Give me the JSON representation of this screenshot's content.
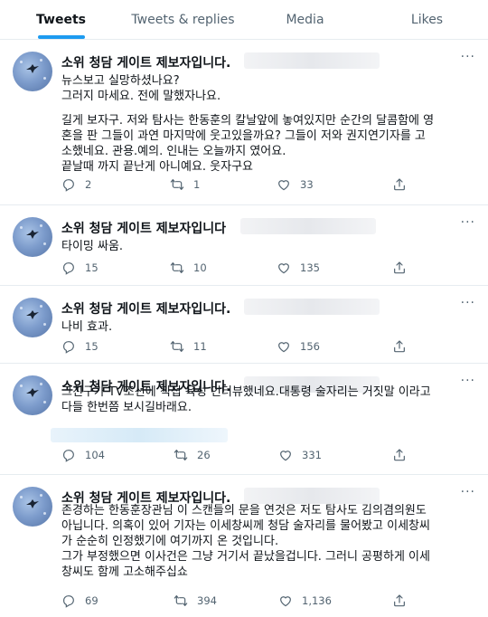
{
  "tabs": [
    {
      "label": "Tweets"
    },
    {
      "label": "Tweets & replies"
    },
    {
      "label": "Media"
    },
    {
      "label": "Likes"
    }
  ],
  "icons": {
    "more": "more-icon",
    "reply": "reply-icon",
    "retweet": "retweet-icon",
    "like": "like-icon",
    "share": "share-icon"
  },
  "colors": {
    "accent": "#1d9bf0",
    "text": "#0f1419",
    "muted": "#536471"
  },
  "tweets": [
    {
      "author": "소위 청담 게이트 제보자입니다.",
      "more": "···",
      "lines": [
        "뉴스보고 실망하셨나요?",
        "그러지 마세요. 전에 말했자나요.",
        "",
        "길게 보자구. 저와 탐사는 한동훈의 칼날앞에 놓여있지만 순간의 달콤함에 영",
        "혼을 판 그들이 과연 마지막에 웃고있을까요? 그들이 저와 권지연기자를 고",
        "소했네요. 관용.예의. 인내는 오늘까지 였어요.",
        "끝날때 까지 끝난게 아니예요. 웃자구요"
      ],
      "replies": "2",
      "retweets": "1",
      "likes": "33"
    },
    {
      "author": "소위 청담 게이트 제보자입니다",
      "more": "···",
      "lines": [
        "타이밍 싸움."
      ],
      "replies": "15",
      "retweets": "10",
      "likes": "135"
    },
    {
      "author": "소위 청담 게이트 제보자입니다.",
      "more": "···",
      "lines": [
        "나비 효과."
      ],
      "replies": "15",
      "retweets": "11",
      "likes": "156"
    },
    {
      "author": "소위 청담 게이트 제보자입니다.",
      "more": "···",
      "lines": [
        "그친구가 TV조선에 직접 육성 인터뷰했네요.대통령 술자리는 거짓말 이라고",
        "다들 한번쯤 보시길바래요."
      ],
      "replies": "104",
      "retweets": "26",
      "likes": "331"
    },
    {
      "author": "소위 청담 게이트 제보자입니다.",
      "more": "···",
      "lines": [
        "존경하는 한동훈장관님 이 스캔들의 문을 연것은 저도 탐사도 김의겸의원도",
        "아닙니다. 의혹이 있어 기자는 이세창씨께 청담 술자리를 물어봤고 이세창씨",
        "가 순순히 인정했기에 여기까지 온 것입니다.",
        "그가 부정했으면 이사건은 그냥 거기서 끝났을겁니다. 그러니 공평하게 이세",
        "창씨도 함께 고소해주십쇼"
      ],
      "replies": "69",
      "retweets": "394",
      "likes": "1,136"
    }
  ]
}
